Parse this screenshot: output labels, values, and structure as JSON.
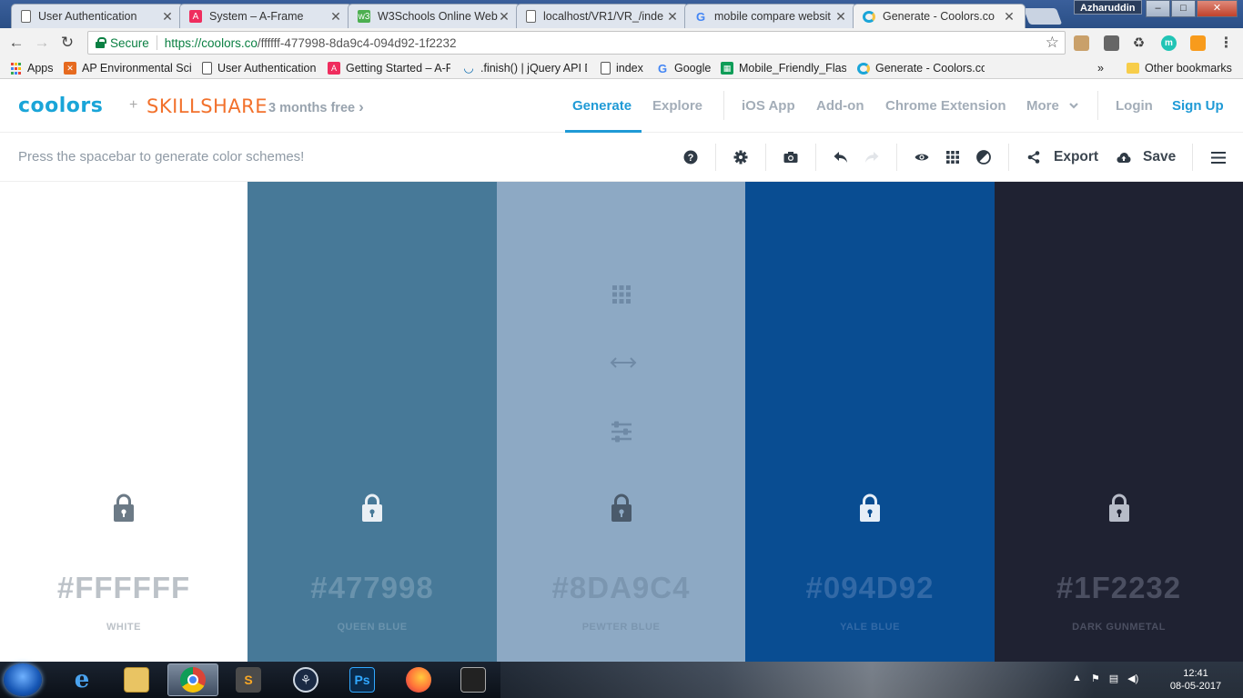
{
  "browser": {
    "tabs": [
      {
        "title": "User Authentication",
        "icon": "doc-icon"
      },
      {
        "title": "System – A-Frame",
        "icon": "aframe-icon"
      },
      {
        "title": "W3Schools Online Web",
        "icon": "w3schools-icon"
      },
      {
        "title": "localhost/VR1/VR_/inde",
        "icon": "doc-icon"
      },
      {
        "title": "mobile compare websit",
        "icon": "google-icon"
      },
      {
        "title": "Generate - Coolors.co",
        "icon": "coolors-icon"
      }
    ],
    "close_glyph": "✕",
    "user": "Azharuddin",
    "window_buttons": {
      "minimize": "–",
      "maximize": "□",
      "close": "✕"
    },
    "nav": {
      "back": "←",
      "forward": "→",
      "reload": "↻"
    },
    "address": {
      "secure_label": "Secure",
      "url_host": "https://coolors.co",
      "url_path": "/ffffff-477998-8da9c4-094d92-1f2232"
    },
    "star_glyph": "☆",
    "bookmarks": [
      {
        "label": "Apps",
        "icon": "apps-icon"
      },
      {
        "label": "AP Environmental Scie",
        "icon": "ap-icon"
      },
      {
        "label": "User Authentication",
        "icon": "doc-icon"
      },
      {
        "label": "Getting Started – A-Fr",
        "icon": "aframe-icon"
      },
      {
        "label": ".finish() | jQuery API D",
        "icon": "jquery-icon"
      },
      {
        "label": "index",
        "icon": "doc-icon"
      },
      {
        "label": "Google",
        "icon": "google-icon"
      },
      {
        "label": "Mobile_Friendly_Flash",
        "icon": "sheets-icon"
      },
      {
        "label": "Generate - Coolors.co",
        "icon": "coolors-icon"
      }
    ],
    "more_bookmarks": "»",
    "other_bookmarks": "Other bookmarks"
  },
  "app": {
    "logo": "coolors",
    "plus": "+",
    "partner": "SKILLSHARE",
    "promo": "3 months free",
    "promo_arrow": "›",
    "nav": {
      "generate": "Generate",
      "explore": "Explore",
      "ios": "iOS App",
      "addon": "Add-on",
      "chrome": "Chrome Extension",
      "more": "More",
      "login": "Login",
      "signup": "Sign Up"
    },
    "hint": "Press the spacebar to generate color schemes!",
    "tools": {
      "export": "Export",
      "save": "Save"
    }
  },
  "palette": [
    {
      "hex": "#FFFFFF",
      "name": "WHITE",
      "bg": "#ffffff",
      "fg": "#bcc2c8",
      "lock": "#6c7a86"
    },
    {
      "hex": "#477998",
      "name": "QUEEN BLUE",
      "bg": "#477998",
      "fg": "#6a93ad",
      "lock": "#e9eff4"
    },
    {
      "hex": "#8DA9C4",
      "name": "PEWTER BLUE",
      "bg": "#8da9c4",
      "fg": "#7b96b0",
      "lock": "#4a5a6b"
    },
    {
      "hex": "#094D92",
      "name": "YALE BLUE",
      "bg": "#094d92",
      "fg": "#3269a6",
      "lock": "#e6eef7"
    },
    {
      "hex": "#1F2232",
      "name": "DARK GUNMETAL",
      "bg": "#1f2232",
      "fg": "#4b4f61",
      "lock": "#b7bcc8"
    }
  ],
  "taskbar": {
    "time": "12:41",
    "date": "08-05-2017"
  }
}
